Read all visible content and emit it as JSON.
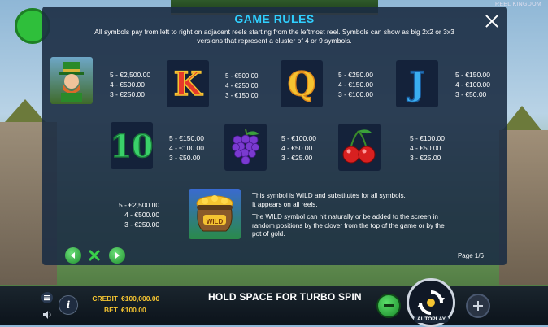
{
  "brand": "REEL KINGDOM",
  "rules": {
    "title": "GAME RULES",
    "intro": "All symbols pay from left to right on adjacent reels starting from the leftmost reel. Symbols can show as big 2x2 or 3x3 versions that represent a cluster of 4 or 9 symbols.",
    "symbols": [
      {
        "name": "leprechaun",
        "pays": [
          "5 - €2,500.00",
          "4 - €500.00",
          "3 - €250.00"
        ]
      },
      {
        "name": "k",
        "glyph": "K",
        "pays": [
          "5 - €500.00",
          "4 - €250.00",
          "3 - €150.00"
        ]
      },
      {
        "name": "q",
        "glyph": "Q",
        "pays": [
          "5 - €250.00",
          "4 - €150.00",
          "3 - €100.00"
        ]
      },
      {
        "name": "j",
        "glyph": "J",
        "pays": [
          "5 - €150.00",
          "4 - €100.00",
          "3 - €50.00"
        ]
      },
      {
        "name": "ten",
        "glyph": "10",
        "pays": [
          "5 - €150.00",
          "4 - €100.00",
          "3 - €50.00"
        ]
      },
      {
        "name": "grapes",
        "pays": [
          "5 - €100.00",
          "4 - €50.00",
          "3 - €25.00"
        ]
      },
      {
        "name": "cherries",
        "pays": [
          "5 - €100.00",
          "4 - €50.00",
          "3 - €25.00"
        ]
      }
    ],
    "wild": {
      "pays": [
        "5 - €2,500.00",
        "4 - €500.00",
        "3 - €250.00"
      ],
      "desc1": "This symbol is WILD and substitutes for all symbols.",
      "desc2": "It appears on all reels.",
      "desc3": "The WILD symbol can hit naturally or be added to the screen in random positions by the clover from the top of the game or by the pot of gold.",
      "pot_label": "WILD"
    },
    "page_label": "Page 1/6"
  },
  "bottom": {
    "credit_label": "CREDIT",
    "credit_value": "€100,000.00",
    "bet_label": "BET",
    "bet_value": "€100.00",
    "turbo_text": "HOLD SPACE FOR TURBO SPIN",
    "autoplay_label": "AUTOPLAY"
  },
  "colors": {
    "title": "#2fd0ff",
    "credit": "#f5c431",
    "nav_green": "#2fb03b"
  }
}
